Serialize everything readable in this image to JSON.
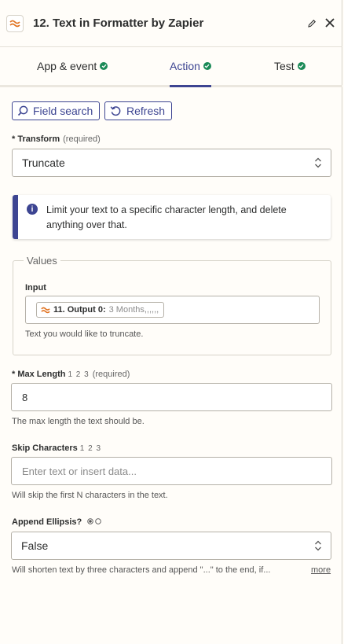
{
  "header": {
    "title": "12. Text in Formatter by Zapier",
    "accent": "#e0701c"
  },
  "tabs": [
    {
      "label": "App & event",
      "status": "complete"
    },
    {
      "label": "Action",
      "status": "complete",
      "active": true
    },
    {
      "label": "Test",
      "status": "complete"
    }
  ],
  "toolbar": {
    "field_search_label": "Field search",
    "refresh_label": "Refresh"
  },
  "transform": {
    "label": "Transform",
    "required": "(required)",
    "value": "Truncate"
  },
  "info": {
    "text": "Limit your text to a specific character length, and delete anything over that."
  },
  "values": {
    "legend": "Values",
    "input_label": "Input",
    "pill_key": "11. Output 0:",
    "pill_value": "3 Months,,,,,,",
    "help": "Text you would like to truncate."
  },
  "max_length": {
    "label": "Max Length",
    "type_hint": "1 2 3",
    "required": "(required)",
    "value": "8",
    "help": "The max length the text should be."
  },
  "skip_characters": {
    "label": "Skip Characters",
    "type_hint": "1 2 3",
    "placeholder": "Enter text or insert data...",
    "help": "Will skip the first N characters in the text."
  },
  "append_ellipsis": {
    "label": "Append Ellipsis?",
    "value": "False",
    "help": "Will shorten text by three characters and append \"...\" to the end, if...",
    "more_label": "more"
  },
  "colors": {
    "primary": "#3d4592",
    "success": "#1a8a57",
    "brand": "#e0701c"
  }
}
